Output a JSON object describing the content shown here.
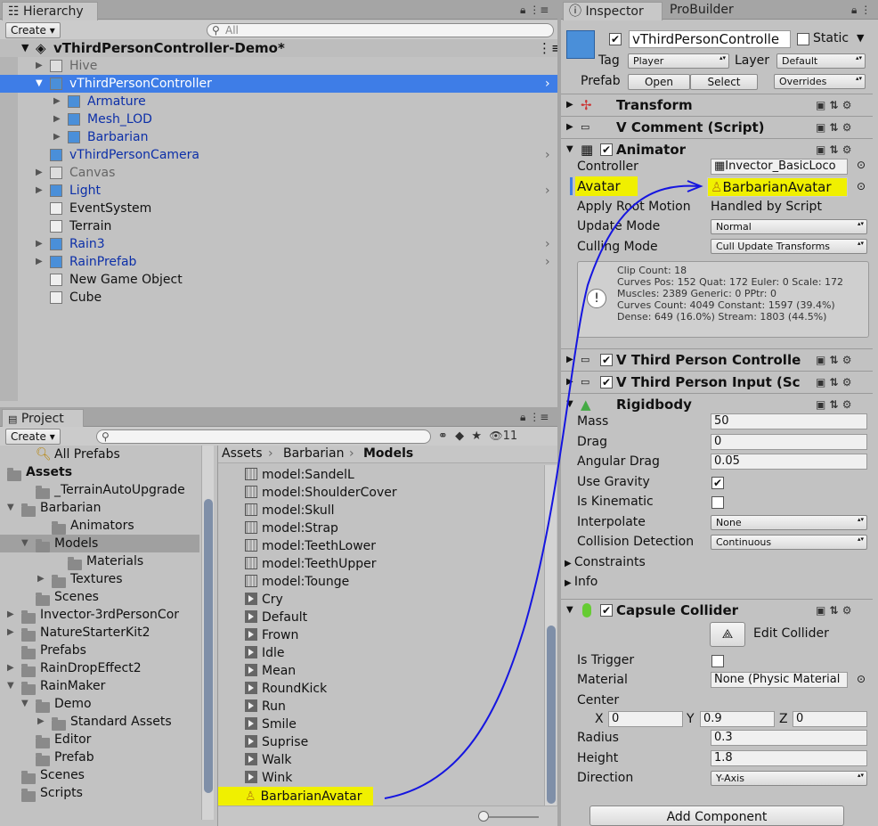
{
  "hierarchy": {
    "tab": "☷ Hierarchy",
    "create": "Create ▾",
    "search_placeholder": "All",
    "scene": "vThirdPersonController-Demo*",
    "items": [
      {
        "label": "Hive",
        "cls": "gray"
      },
      {
        "label": "vThirdPersonController",
        "cls": "sel"
      },
      {
        "label": "Armature",
        "cls": "blue"
      },
      {
        "label": "Mesh_LOD",
        "cls": "blue"
      },
      {
        "label": "Barbarian",
        "cls": "blue"
      },
      {
        "label": "vThirdPersonCamera",
        "cls": "blue"
      },
      {
        "label": "Canvas",
        "cls": "gray"
      },
      {
        "label": "Light",
        "cls": "blue"
      },
      {
        "label": "EventSystem",
        "cls": ""
      },
      {
        "label": "Terrain",
        "cls": ""
      },
      {
        "label": "Rain3",
        "cls": "blue"
      },
      {
        "label": "RainPrefab",
        "cls": "blue"
      },
      {
        "label": "New Game Object",
        "cls": ""
      },
      {
        "label": "Cube",
        "cls": ""
      }
    ]
  },
  "project": {
    "tab": "Project",
    "create": "Create ▾",
    "count": "11",
    "tree": [
      "All Prefabs",
      "Assets",
      "_TerrainAutoUpgrade",
      "Barbarian",
      "Animators",
      "Models",
      "Materials",
      "Textures",
      "Scenes",
      "Invector-3rdPersonCor",
      "NatureStarterKit2",
      "Prefabs",
      "RainDropEffect2",
      "RainMaker",
      "Demo",
      "Standard Assets",
      "Editor",
      "Prefab",
      "Scenes",
      "Scripts"
    ],
    "breadcrumb": [
      "Assets",
      "Barbarian",
      "Models"
    ],
    "files": [
      {
        "label": "model:SandelL",
        "t": "mesh"
      },
      {
        "label": "model:ShoulderCover",
        "t": "mesh"
      },
      {
        "label": "model:Skull",
        "t": "mesh"
      },
      {
        "label": "model:Strap",
        "t": "mesh"
      },
      {
        "label": "model:TeethLower",
        "t": "mesh"
      },
      {
        "label": "model:TeethUpper",
        "t": "mesh"
      },
      {
        "label": "model:Tounge",
        "t": "mesh"
      },
      {
        "label": "Cry",
        "t": "anim"
      },
      {
        "label": "Default",
        "t": "anim"
      },
      {
        "label": "Frown",
        "t": "anim"
      },
      {
        "label": "Idle",
        "t": "anim"
      },
      {
        "label": "Mean",
        "t": "anim"
      },
      {
        "label": "RoundKick",
        "t": "anim"
      },
      {
        "label": "Run",
        "t": "anim"
      },
      {
        "label": "Smile",
        "t": "anim"
      },
      {
        "label": "Suprise",
        "t": "anim"
      },
      {
        "label": "Walk",
        "t": "anim"
      },
      {
        "label": "Wink",
        "t": "anim"
      },
      {
        "label": "BarbarianAvatar",
        "t": "avatar"
      }
    ]
  },
  "inspector": {
    "tab": "Inspector",
    "tab2": "ProBuilder",
    "name": "vThirdPersonControlle",
    "static": "Static",
    "tag_label": "Tag",
    "tag": "Player",
    "layer_label": "Layer",
    "layer": "Default",
    "prefab_label": "Prefab",
    "open": "Open",
    "select": "Select",
    "overrides": "Overrides",
    "transform": "Transform",
    "comment": "V Comment (Script)",
    "animator": "Animator",
    "controller_label": "Controller",
    "controller": "Invector_BasicLoco",
    "avatar_label": "Avatar",
    "avatar": "BarbarianAvatar",
    "root_motion_label": "Apply Root Motion",
    "root_motion": "Handled by Script",
    "update_label": "Update Mode",
    "update": "Normal",
    "culling_label": "Culling Mode",
    "culling": "Cull Update Transforms",
    "info": [
      "Clip Count: 18",
      "Curves Pos: 152 Quat: 172 Euler: 0 Scale: 172",
      "Muscles: 2389 Generic: 0 PPtr: 0",
      "Curves Count: 4049 Constant: 1597 (39.4%)",
      "Dense: 649 (16.0%) Stream: 1803 (44.5%)"
    ],
    "tpc": "V Third Person Controlle",
    "tpi": "V Third Person Input (Sc",
    "rigidbody": "Rigidbody",
    "mass_label": "Mass",
    "mass": "50",
    "drag_label": "Drag",
    "drag": "0",
    "adrag_label": "Angular Drag",
    "adrag": "0.05",
    "gravity_label": "Use Gravity",
    "kinematic_label": "Is Kinematic",
    "interp_label": "Interpolate",
    "interp": "None",
    "coll_label": "Collision Detection",
    "coll": "Continuous",
    "constraints": "Constraints",
    "info_label": "Info",
    "capsule": "Capsule Collider",
    "edit_collider": "Edit Collider",
    "trigger_label": "Is Trigger",
    "material_label": "Material",
    "material": "None (Physic Material",
    "center_label": "Center",
    "cx": "0",
    "cy": "0.9",
    "cz": "0",
    "radius_label": "Radius",
    "radius": "0.3",
    "height_label": "Height",
    "height": "1.8",
    "direction_label": "Direction",
    "direction": "Y-Axis",
    "add_component": "Add Component"
  }
}
